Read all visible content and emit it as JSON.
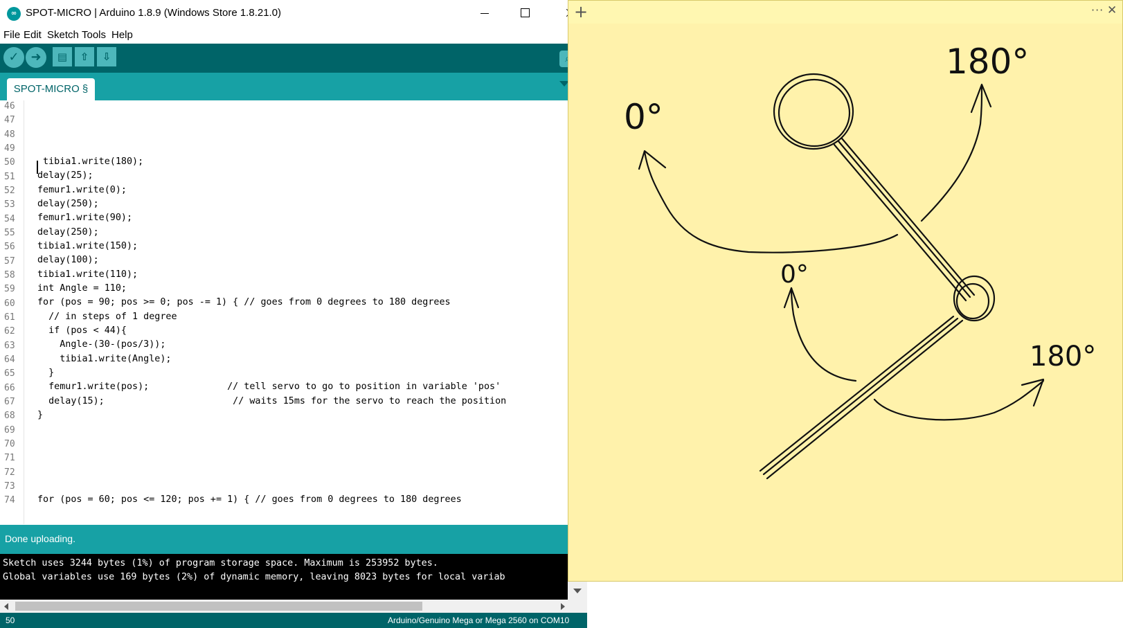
{
  "window": {
    "title": "SPOT-MICRO | Arduino 1.8.9 (Windows Store 1.8.21.0)"
  },
  "menu": [
    "File",
    "Edit",
    "Sketch",
    "Tools",
    "Help"
  ],
  "toolbar": {
    "verify_icon": "checkmark-icon",
    "upload_icon": "right-arrow-icon",
    "new_icon": "new-file-icon",
    "open_icon": "up-arrow-icon",
    "save_icon": "down-arrow-icon",
    "serial_monitor_icon": "magnifier-icon"
  },
  "tab": {
    "label": "SPOT-MICRO §"
  },
  "editor": {
    "line_numbers": [
      "46",
      "47",
      "48",
      "49",
      "50",
      "51",
      "52",
      "53",
      "54",
      "55",
      "56",
      "57",
      "58",
      "59",
      "60",
      "61",
      "62",
      "63",
      "64",
      "65",
      "66",
      "67",
      "68",
      "69",
      "70",
      "71",
      "72",
      "73",
      "74"
    ],
    "code_lines": [
      "",
      "",
      "",
      "",
      " tibia1.write(180);",
      "delay(25);",
      "femur1.write(0);",
      "delay(250);",
      "femur1.write(90);",
      "delay(250);",
      "tibia1.write(150);",
      "delay(100);",
      "tibia1.write(110);",
      "int Angle = 110;",
      "for (pos = 90; pos >= 0; pos -= 1) { // goes from 0 degrees to 180 degrees",
      "  // in steps of 1 degree",
      "  if (pos < 44){",
      "    Angle-(30-(pos/3));",
      "    tibia1.write(Angle);",
      "  }",
      "  femur1.write(pos);              // tell servo to go to position in variable 'pos'",
      "  delay(15);                       // waits 15ms for the servo to reach the position",
      "}",
      "",
      "",
      "",
      "",
      "",
      "for (pos = 60; pos <= 120; pos += 1) { // goes from 0 degrees to 180 degrees"
    ]
  },
  "status": {
    "message": "Done uploading."
  },
  "console": {
    "lines": [
      "Sketch uses 3244 bytes (1%) of program storage space. Maximum is 253952 bytes.",
      "Global variables use 169 bytes (2%) of dynamic memory, leaving 8023 bytes for local variab"
    ]
  },
  "footer": {
    "line": "50",
    "board": "Arduino/Genuino Mega or Mega 2560 on COM10"
  },
  "sticky_note": {
    "add_icon": "plus-icon",
    "menu_icon": "more-icon",
    "close_icon": "close-icon",
    "labels": {
      "upper_left": "0°",
      "upper_right": "180°",
      "lower_left": "0°",
      "lower_right": "180°"
    }
  },
  "colors": {
    "arduino_dark": "#006468",
    "arduino_teal": "#17a1a5",
    "sticky_yellow": "#fff2ab",
    "keyword": "#d35400"
  }
}
